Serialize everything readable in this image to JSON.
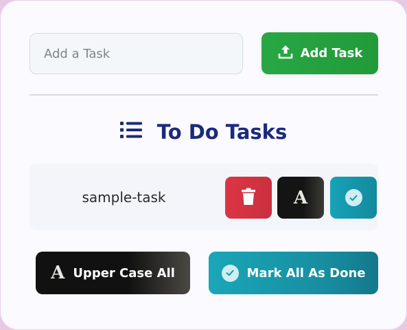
{
  "input": {
    "placeholder": "Add a Task",
    "value": ""
  },
  "add_button": {
    "label": "Add Task",
    "icon": "upload-icon"
  },
  "heading": {
    "title": "To Do Tasks",
    "icon": "list-icon",
    "color": "#1c2a7a"
  },
  "tasks": [
    {
      "label": "sample-task"
    }
  ],
  "task_actions": {
    "delete_icon": "trash-icon",
    "uppercase_icon": "font-a-icon",
    "done_icon": "check-circle-icon"
  },
  "footer": {
    "uppercase_all_label": "Upper Case All",
    "mark_all_label": "Mark All As Done"
  },
  "colors": {
    "green": "#28a745",
    "red": "#dc3545",
    "teal": "#17a2b8",
    "dark": "#141414"
  }
}
